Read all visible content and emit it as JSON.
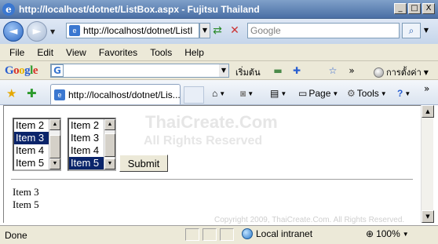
{
  "window": {
    "title": "http://localhost/dotnet/ListBox.aspx - Fujitsu Thailand",
    "buttons": {
      "minimize": "_",
      "maximize": "□",
      "close": "X"
    }
  },
  "nav": {
    "back_label": "◄",
    "forward_label": "►",
    "address": "http://localhost/dotnet/ListI",
    "search_placeholder": "Google"
  },
  "menu": {
    "items": [
      "File",
      "Edit",
      "View",
      "Favorites",
      "Tools",
      "Help"
    ]
  },
  "google_toolbar": {
    "logo": "Google",
    "search_label": "เริ่มต้น",
    "settings_label": "การตั้งค่า"
  },
  "command_bar": {
    "tab_title": "http://localhost/dotnet/Lis...",
    "page_label": "Page",
    "tools_label": "Tools"
  },
  "page": {
    "listbox1": {
      "items": [
        {
          "label": "Item 2",
          "selected": false
        },
        {
          "label": "Item 3",
          "selected": true
        },
        {
          "label": "Item 4",
          "selected": false
        },
        {
          "label": "Item 5",
          "selected": false
        }
      ]
    },
    "listbox2": {
      "items": [
        {
          "label": "Item 2",
          "selected": false
        },
        {
          "label": "Item 3",
          "selected": false
        },
        {
          "label": "Item 4",
          "selected": false
        },
        {
          "label": "Item 5",
          "selected": true
        }
      ]
    },
    "submit_label": "Submit",
    "results": [
      "Item 3",
      "Item 5"
    ],
    "watermark": {
      "line1": "ThaiCreate.Com",
      "line2": "All Rights Reserved",
      "copyright": "Copyright 2009, ThaiCreate.Com. All Rights Reserved."
    }
  },
  "status": {
    "text": "Done",
    "zone": "Local intranet",
    "zoom": "100%"
  },
  "colors": {
    "selection": "#0a246a",
    "titlebar": "#4a6fa5"
  }
}
